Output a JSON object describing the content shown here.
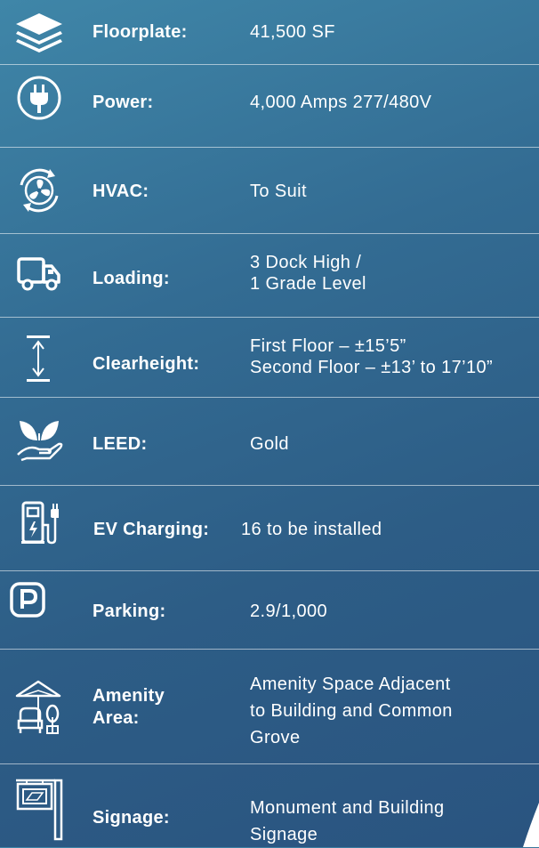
{
  "specs": [
    {
      "label": "Floorplate:",
      "value": [
        "41,500 SF"
      ],
      "icon": "layers-icon"
    },
    {
      "label": "Power:",
      "value": [
        "4,000 Amps 277/480V"
      ],
      "icon": "power-plug-icon"
    },
    {
      "label": "HVAC:",
      "value": [
        "To Suit"
      ],
      "icon": "fan-icon"
    },
    {
      "label": "Loading:",
      "value": [
        "3 Dock High /",
        "1 Grade Level"
      ],
      "icon": "truck-icon"
    },
    {
      "label": "Clearheight:",
      "value": [
        "First Floor – ±15’5”",
        "Second Floor – ±13’ to 17’10”"
      ],
      "icon": "height-arrow-icon"
    },
    {
      "label": "LEED:",
      "value": [
        "Gold"
      ],
      "icon": "leaf-hand-icon"
    },
    {
      "label": "EV Charging:",
      "value": [
        "16 to be installed"
      ],
      "icon": "ev-charger-icon"
    },
    {
      "label": "Parking:",
      "value": [
        "2.9/1,000"
      ],
      "icon": "parking-icon"
    },
    {
      "label": [
        "Amenity",
        "Area:"
      ],
      "value": [
        "Amenity Space Adjacent",
        "to Building and Common",
        "Grove"
      ],
      "icon": "amenity-umbrella-icon"
    },
    {
      "label": "Signage:",
      "value": [
        "Monument and Building",
        "Signage"
      ],
      "icon": "sign-icon"
    }
  ],
  "colors": {
    "background_top": "#3f86a8",
    "background_bottom": "#2a5480",
    "text": "#ffffff"
  }
}
